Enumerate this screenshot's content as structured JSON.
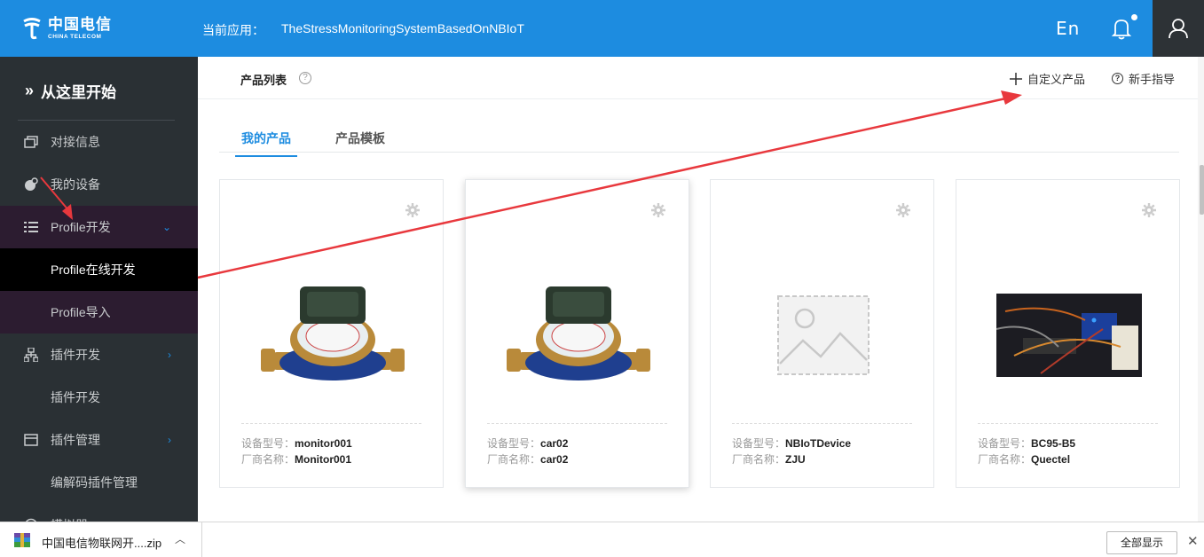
{
  "header": {
    "logo_cn": "中国电信",
    "logo_en": "CHINA TELECOM",
    "app_label": "当前应用：",
    "app_name": "TheStressMonitoringSystemBasedOnNBIoT",
    "lang": "En"
  },
  "sidebar": {
    "start": "从这里开始",
    "items": [
      {
        "label": "对接信息",
        "icon": "window-icon"
      },
      {
        "label": "我的设备",
        "icon": "device-icon"
      },
      {
        "label": "Profile开发",
        "icon": "list-icon"
      },
      {
        "label": "Profile在线开发"
      },
      {
        "label": "Profile导入"
      },
      {
        "label": "插件开发",
        "icon": "plugin-tree-icon"
      },
      {
        "label": "插件开发"
      },
      {
        "label": "插件管理",
        "icon": "panel-icon"
      },
      {
        "label": "编解码插件管理"
      },
      {
        "label": "模拟器",
        "icon": "simulator-icon"
      }
    ]
  },
  "main": {
    "list_title": "产品列表",
    "custom_product": "自定义产品",
    "guide": "新手指导",
    "tabs": [
      {
        "label": "我的产品",
        "active": true
      },
      {
        "label": "产品模板",
        "active": false
      }
    ],
    "model_label": "设备型号：",
    "vendor_label": "厂商名称：",
    "products": [
      {
        "model": "monitor001",
        "vendor": "Monitor001",
        "image": "water-meter"
      },
      {
        "model": "car02",
        "vendor": "car02",
        "image": "water-meter"
      },
      {
        "model": "NBIoTDevice",
        "vendor": "ZJU",
        "image": "placeholder"
      },
      {
        "model": "BC95-B5",
        "vendor": "Quectel",
        "image": "circuit-board"
      }
    ]
  },
  "download_bar": {
    "file_name": "中国电信物联网开....zip",
    "show_all": "全部显示"
  },
  "colors": {
    "header_blue": "#1d8ce0",
    "sidebar_bg": "#2a3034",
    "annotation_red": "#e8383d"
  }
}
